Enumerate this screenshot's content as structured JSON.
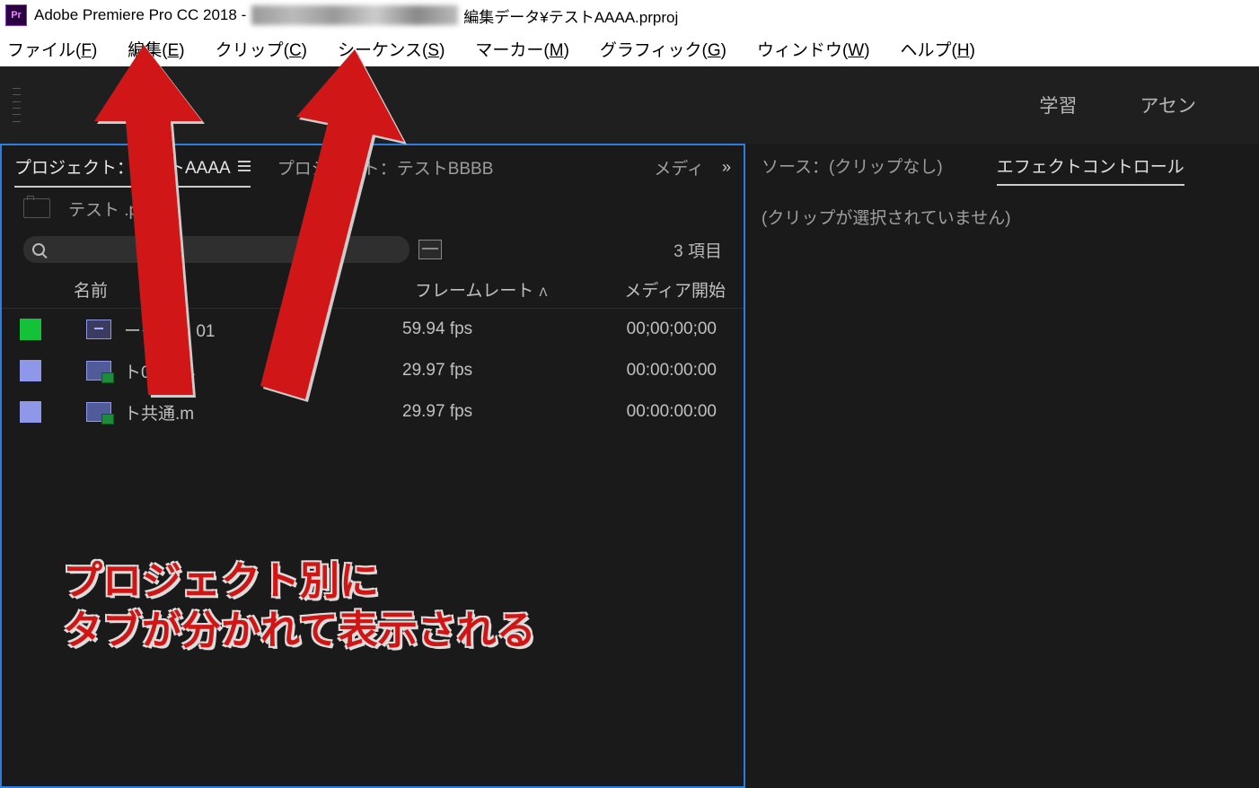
{
  "title": {
    "app": "Adobe Premiere Pro CC 2018 - ",
    "suffix": "編集データ¥テストAAAA.prproj"
  },
  "menus": {
    "file": {
      "label": "ファイル(",
      "key": "F",
      "tail": ")"
    },
    "edit": {
      "label": "編集(",
      "key": "E",
      "tail": ")"
    },
    "clip": {
      "label": "クリップ(",
      "key": "C",
      "tail": ")"
    },
    "sequence": {
      "label": "シーケンス(",
      "key": "S",
      "tail": ")"
    },
    "marker": {
      "label": "マーカー(",
      "key": "M",
      "tail": ")"
    },
    "graphics": {
      "label": "グラフィック(",
      "key": "G",
      "tail": ")"
    },
    "window": {
      "label": "ウィンドウ(",
      "key": "W",
      "tail": ")"
    },
    "help": {
      "label": "ヘルプ(",
      "key": "H",
      "tail": ")"
    }
  },
  "workspace": {
    "learn": "学習",
    "assembly": "アセン"
  },
  "project_panel": {
    "tabs": {
      "a": "プロジェクト：テストAAAA",
      "b": "プロジェクト：テストBBBB",
      "media": "メディ"
    },
    "proj_file": "テスト            .prproj",
    "items_count": "3 項目",
    "columns": {
      "name": "名前",
      "fps": "フレームレート",
      "start": "メディア開始"
    },
    "rows": [
      {
        "swatch": "green",
        "name": "ーケンス 01",
        "fps": "59.94 fps",
        "start": "00;00;00;00",
        "kind": "seq"
      },
      {
        "swatch": "lav",
        "name": "ト0. MP4",
        "fps": "29.97 fps",
        "start": "00:00:00:00",
        "kind": "vid"
      },
      {
        "swatch": "lav",
        "name": "ト共通.m",
        "fps": "29.97 fps",
        "start": "00:00:00:00",
        "kind": "vid"
      }
    ]
  },
  "source_panel": {
    "source_tab": "ソース：(クリップなし)",
    "effects_tab": "エフェクトコントロール",
    "no_clip": "(クリップが選択されていません)"
  },
  "annotation": {
    "line1": "プロジェクト別に",
    "line2": "タブが分かれて表示される"
  },
  "logo": "Pr",
  "chevron": "»"
}
